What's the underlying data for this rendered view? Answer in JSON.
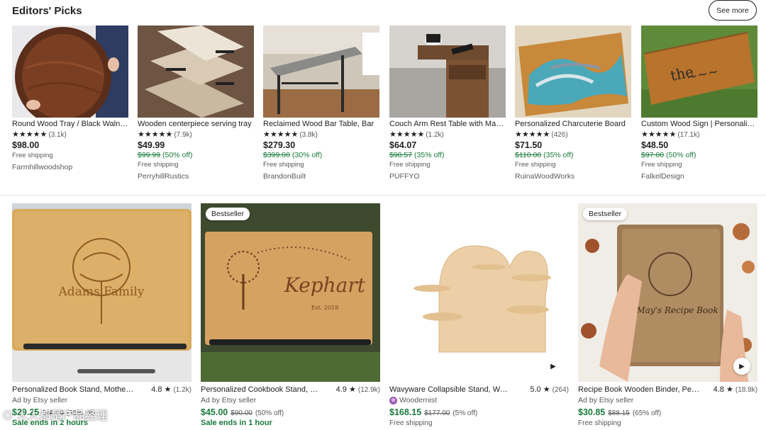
{
  "section": {
    "title": "Editors' Picks",
    "see_more": "See more"
  },
  "picks": [
    {
      "title": "Round Wood Tray / Black Walnut Tray",
      "stars": "★★★★★",
      "reviews": "(3.1k)",
      "price": "$98.00",
      "original": "",
      "discount": "",
      "shipping": "Free shipping",
      "shop": "Farmhillwoodshop"
    },
    {
      "title": "Wooden centerpiece serving tray",
      "stars": "★★★★★",
      "reviews": "(7.9k)",
      "price": "$49.99",
      "original": "$99.99",
      "discount": "(50% off)",
      "shipping": "Free shipping",
      "shop": "PerryhillRustics"
    },
    {
      "title": "Reclaimed Wood Bar Table, Bar",
      "stars": "★★★★★",
      "reviews": "(3.8k)",
      "price": "$279.30",
      "original": "$399.00",
      "discount": "(30% off)",
      "shipping": "Free shipping",
      "shop": "BrandonBuilt"
    },
    {
      "title": "Couch Arm Rest Table with Magazine",
      "stars": "★★★★★",
      "reviews": "(1.2k)",
      "price": "$64.07",
      "original": "$98.57",
      "discount": "(35% off)",
      "shipping": "Free shipping",
      "shop": "PUFFYO"
    },
    {
      "title": "Personalized Charcuterie Board",
      "stars": "★★★★★",
      "reviews": "(426)",
      "price": "$71.50",
      "original": "$110.00",
      "discount": "(35% off)",
      "shipping": "Free shipping",
      "shop": "RuinaWoodWorks"
    },
    {
      "title": "Custom Wood Sign | Personalized",
      "stars": "★★★★★",
      "reviews": "(17.1k)",
      "price": "$48.50",
      "original": "$97.00",
      "discount": "(50% off)",
      "shipping": "Free shipping",
      "shop": "FalkelDesign"
    }
  ],
  "ads": [
    {
      "badge": "",
      "title": "Personalized Book Stand, Mother's Day",
      "rating": "4.8 ★",
      "reviews": "(1.2k)",
      "seller": "Ad by Etsy seller",
      "price": "$29.25",
      "original": "$45.00",
      "discount": "(35% off)",
      "sale_end": "Sale ends in 2 hours",
      "shipping": "",
      "engraving": "Adams Family"
    },
    {
      "badge": "Bestseller",
      "title": "Personalized Cookbook Stand, Recipe",
      "rating": "4.9 ★",
      "reviews": "(12.9k)",
      "seller": "Ad by Etsy seller",
      "price": "$45.00",
      "original": "$90.00",
      "discount": "(50% off)",
      "sale_end": "Sale ends in 1 hour",
      "shipping": "",
      "engraving": "Kephart",
      "engraving_sub": "Est. 2018"
    },
    {
      "badge": "",
      "title": "Wavyware Collapsible Stand, Wood",
      "rating": "5.0 ★",
      "reviews": "(264)",
      "seller": "Woodernist",
      "price": "$168.15",
      "original": "$177.00",
      "discount": "(5% off)",
      "sale_end": "",
      "shipping": "Free shipping"
    },
    {
      "badge": "Bestseller",
      "title": "Recipe Book Wooden Binder, Personalized",
      "rating": "4.8 ★",
      "reviews": "(18.8k)",
      "seller": "Ad by Etsy seller",
      "price": "$30.85",
      "original": "$88.15",
      "discount": "(65% off)",
      "sale_end": "",
      "shipping": "Free shipping",
      "engraving": "May's Recipe Book"
    }
  ],
  "play_icon": "▶",
  "watermark": "⊙ 人人都是产品经理",
  "colors": {
    "sale_green": "#1a7a3c",
    "text": "#222222",
    "muted": "#595959"
  }
}
